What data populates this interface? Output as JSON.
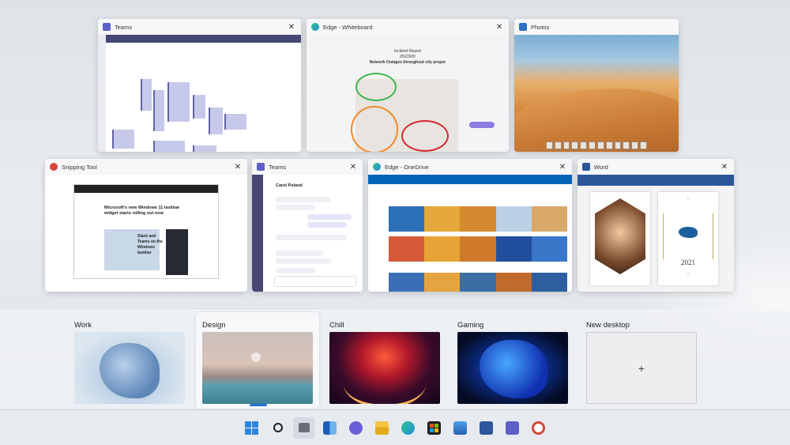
{
  "windows": [
    {
      "id": "teams-calendar",
      "title": "Teams",
      "icon": "teams-icon",
      "accent": "#5b5fc7"
    },
    {
      "id": "edge-whiteboard",
      "title": "Edge - Whiteboard",
      "icon": "edge-icon",
      "accent": "#1f8fd6"
    },
    {
      "id": "photos",
      "title": "Photos",
      "icon": "photos-icon",
      "accent": "#2f6fc5"
    },
    {
      "id": "snipping-tool",
      "title": "Snipping Tool",
      "icon": "snipping-tool-icon",
      "accent": "#d8463a"
    },
    {
      "id": "teams-chat",
      "title": "Teams",
      "icon": "teams-icon",
      "accent": "#5b5fc7"
    },
    {
      "id": "edge-onedrive",
      "title": "Edge - OneDrive",
      "icon": "edge-icon",
      "accent": "#1f8fd6"
    },
    {
      "id": "word",
      "title": "Word",
      "icon": "word-icon",
      "accent": "#2b579a"
    }
  ],
  "whiteboard": {
    "heading1": "Incident Report",
    "heading2": "05/23/20",
    "heading3": "Network Outages throughout city proper"
  },
  "snipping": {
    "headline": "Microsoft's new Windows 11 taskbar widget starts rolling out now",
    "side_text": "Slack and Teams on the Windows taskbar"
  },
  "teams_chat": {
    "contact": "Carol Poland"
  },
  "word": {
    "year": "2021"
  },
  "desktops": [
    {
      "label": "Work",
      "selected": false
    },
    {
      "label": "Design",
      "selected": true
    },
    {
      "label": "Chill",
      "selected": false
    },
    {
      "label": "Gaming",
      "selected": false
    },
    {
      "label": "New desktop",
      "selected": false,
      "plus": "+"
    }
  ],
  "taskbar": {
    "items": [
      "start-icon",
      "search-icon",
      "task-view-icon",
      "widgets-icon",
      "teams-chat-icon",
      "file-explorer-icon",
      "edge-icon",
      "store-icon",
      "photos-icon",
      "word-icon",
      "teams-icon",
      "snipping-tool-icon"
    ],
    "active": "task-view-icon"
  }
}
